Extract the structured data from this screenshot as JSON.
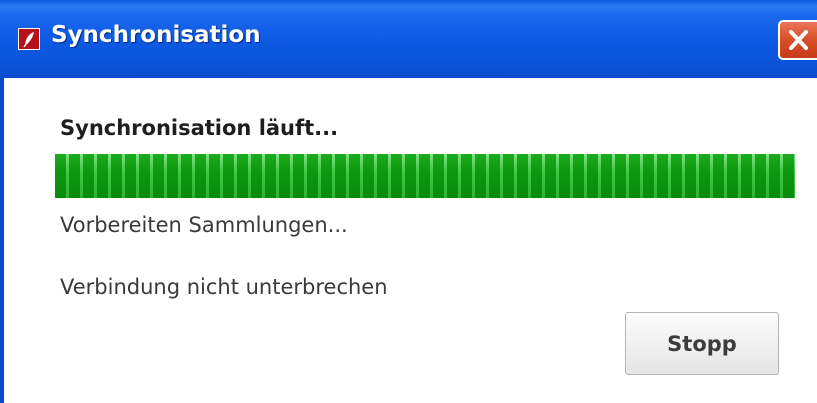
{
  "window": {
    "title": "Synchronisation",
    "icon": "app-feather-icon",
    "close_icon": "close-icon"
  },
  "dialog": {
    "heading": "Synchronisation läuft...",
    "progress_percent": 100,
    "status": "Vorbereiten Sammlungen...",
    "hint": "Verbindung nicht unterbrechen",
    "stop_label": "Stopp"
  },
  "colors": {
    "titlebar": "#0a58e0",
    "close_button": "#d9512b",
    "progress_fill": "#35c23c"
  }
}
